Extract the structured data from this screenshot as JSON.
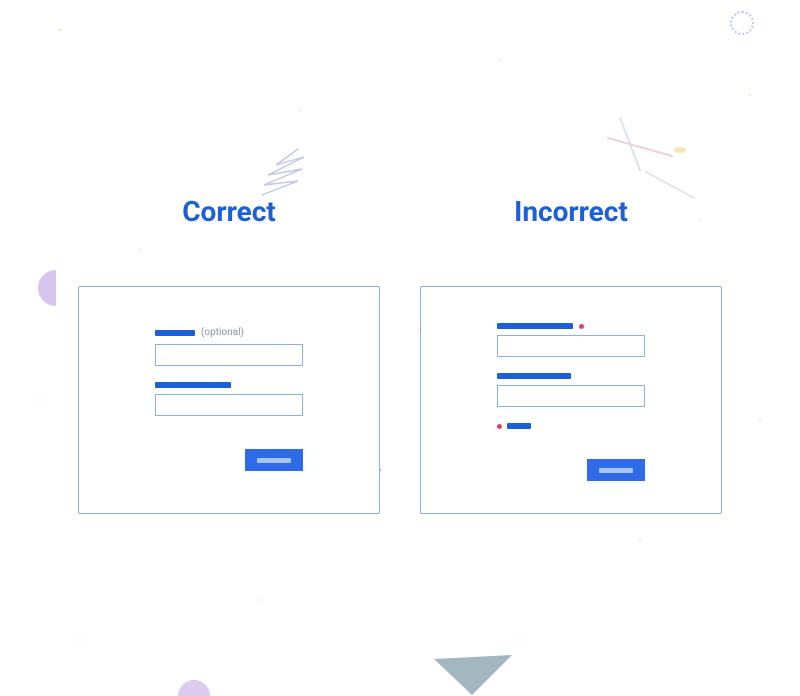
{
  "headings": {
    "correct": "Correct",
    "incorrect": "Incorrect"
  },
  "correct_card": {
    "field1": {
      "label_width": 40,
      "optional_text": "(optional)"
    },
    "field2": {
      "label_width": 76
    }
  },
  "incorrect_card": {
    "field1": {
      "label_width": 76,
      "required": true
    },
    "field2": {
      "label_width": 74
    },
    "legend": {
      "required": true,
      "label_width": 24
    }
  },
  "colors": {
    "heading": "#1b5fd9",
    "accent": "#1b5fd9",
    "border": "#8bb0f0",
    "button": "#2e6be9",
    "required_marker": "#e43b7a",
    "optional_text": "#8a95a5"
  }
}
